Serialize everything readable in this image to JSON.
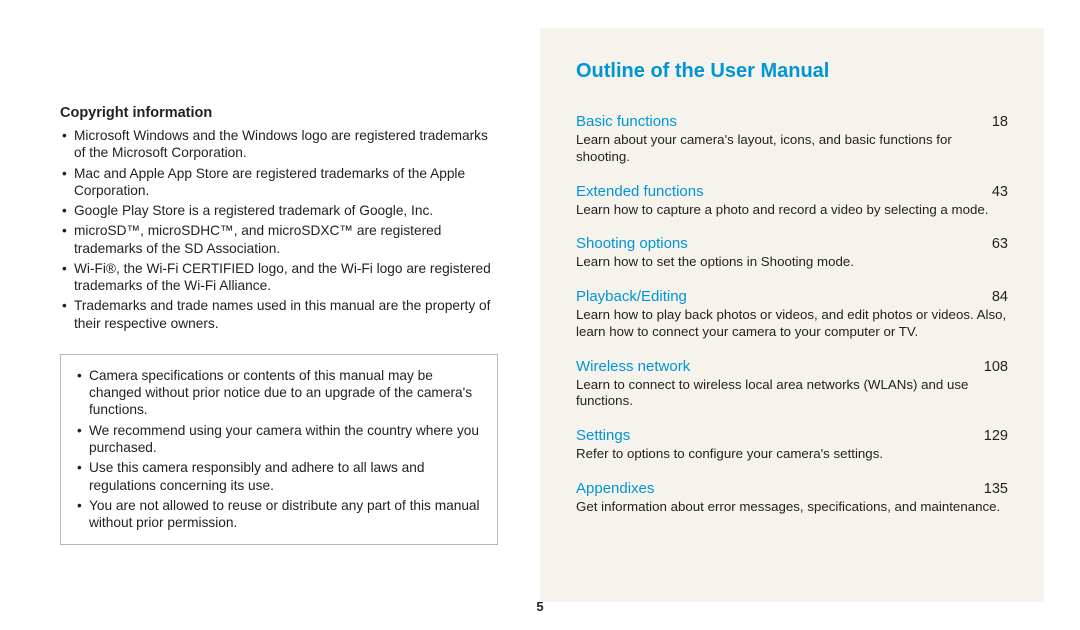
{
  "left": {
    "copyright_heading": "Copyright information",
    "trademarks": [
      "Microsoft Windows and the Windows logo are registered trademarks of the Microsoft Corporation.",
      "Mac and Apple App Store are registered trademarks of the Apple Corporation.",
      "Google Play Store is a registered trademark of Google, Inc.",
      "microSD™, microSDHC™, and microSDXC™ are registered trademarks of the SD Association.",
      "Wi-Fi®, the Wi-Fi CERTIFIED logo, and the Wi-Fi logo are registered trademarks of the Wi-Fi Alliance.",
      "Trademarks and trade names used in this manual are the property of their respective owners."
    ],
    "notices": [
      "Camera specifications or contents of this manual may be changed without prior notice due to an upgrade of the camera's functions.",
      "We recommend using your camera within the country where you purchased.",
      "Use this camera responsibly and adhere to all laws and regulations concerning its use.",
      "You are not allowed to reuse or distribute any part of this manual without prior permission."
    ]
  },
  "right": {
    "title": "Outline of the User Manual",
    "sections": [
      {
        "label": "Basic functions",
        "page": "18",
        "desc": "Learn about your camera's layout, icons, and basic functions for shooting."
      },
      {
        "label": "Extended functions",
        "page": "43",
        "desc": "Learn how to capture a photo and record a video by selecting a mode."
      },
      {
        "label": "Shooting options",
        "page": "63",
        "desc": "Learn how to set the options in Shooting mode."
      },
      {
        "label": "Playback/Editing",
        "page": "84",
        "desc": "Learn how to play back photos or videos, and edit photos or videos. Also, learn how to connect your camera to your computer or TV."
      },
      {
        "label": "Wireless network",
        "page": "108",
        "desc": "Learn to connect to wireless local area networks (WLANs) and use functions."
      },
      {
        "label": "Settings",
        "page": "129",
        "desc": "Refer to options to configure your camera's settings."
      },
      {
        "label": "Appendixes",
        "page": "135",
        "desc": "Get information about error messages, specifications, and maintenance."
      }
    ]
  },
  "page_number": "5"
}
